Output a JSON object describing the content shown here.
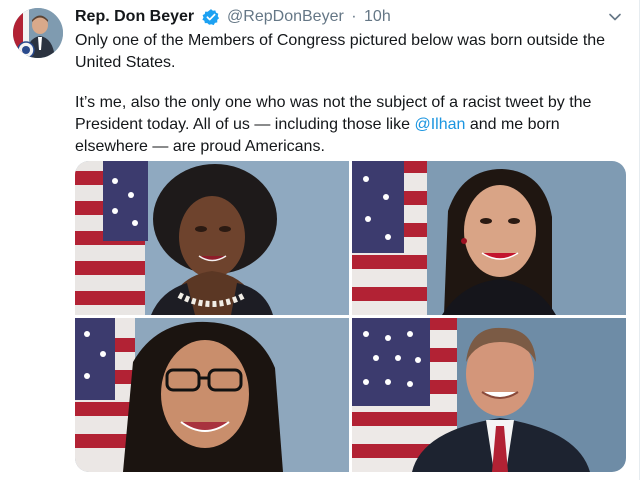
{
  "tweet": {
    "author_name": "Rep. Don Beyer",
    "handle": "@RepDonBeyer",
    "separator": "·",
    "time": "10h",
    "paragraph1": "Only one of the Members of Congress pictured below was born outside the United States.",
    "paragraph2_part1": "It’s me, also the only one who was not the subject of a racist tweet by the President today. All of us — including those like ",
    "mention": "@Ilhan",
    "paragraph2_part2": " and me born elsewhere — are proud Americans."
  },
  "icons": {
    "verified": "verified-badge-icon",
    "caret": "chevron-down-icon"
  },
  "colors": {
    "text": "#14171a",
    "secondary": "#657786",
    "link": "#1b95e0",
    "verified": "#1da1f2",
    "flag_red": "#b22234",
    "flag_blue": "#3c3b6e",
    "photo_background": "#7a97ae"
  },
  "media": {
    "photos": [
      {
        "name": "photo-woman-braids"
      },
      {
        "name": "photo-woman-dark-hair"
      },
      {
        "name": "photo-woman-glasses"
      },
      {
        "name": "photo-man-suit"
      }
    ]
  }
}
